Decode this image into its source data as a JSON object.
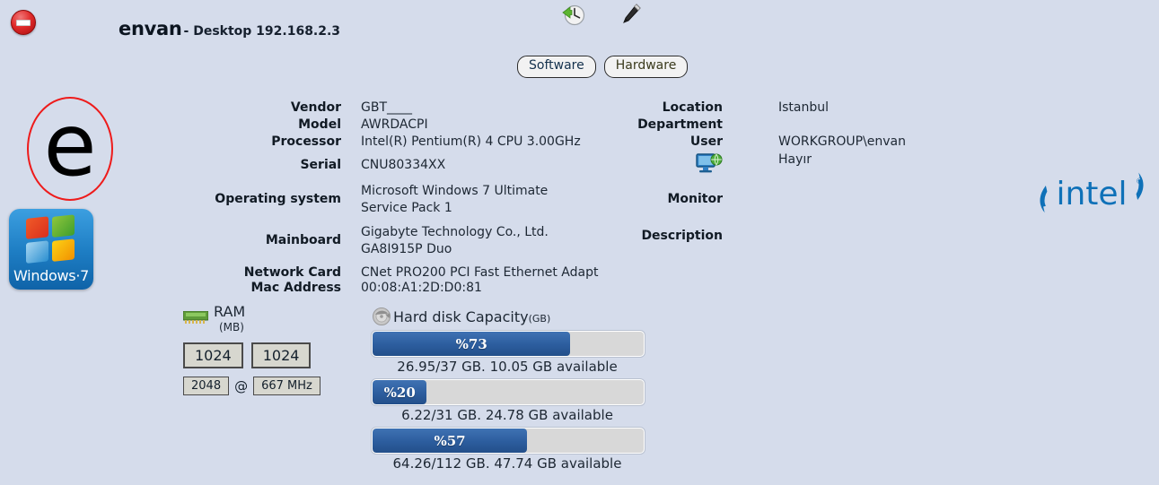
{
  "header": {
    "stop_icon": "stop-icon",
    "hostname": "envan",
    "subtitle": "- Desktop 192.168.2.3",
    "history_icon": "history-clock-icon",
    "pen_icon": "pen-edit-icon"
  },
  "tabs": [
    {
      "label": "Software",
      "name": "tab-software"
    },
    {
      "label": "Hardware",
      "name": "tab-hardware"
    }
  ],
  "branding": {
    "e_logo_letter": "e",
    "windows_logo_text": "Windows·7",
    "intel_logo_text": "intel",
    "ring_color": "#ee1b1b",
    "intel_blue": "#0f71b8"
  },
  "left_info": [
    {
      "label": "Vendor",
      "value": "GBT____"
    },
    {
      "label": "Model",
      "value": "AWRDACPI"
    },
    {
      "label": "Processor",
      "value": "Intel(R) Pentium(R) 4 CPU 3.00GHz"
    },
    {
      "label": "Serial",
      "value": "CNU80334XX"
    },
    {
      "label": "Operating system",
      "value": "Microsoft Windows 7 Ultimate\nService Pack 1"
    },
    {
      "label": "Mainboard",
      "value": "Gigabyte Technology Co., Ltd.\nGA8I915P Duo"
    },
    {
      "label": "Network Card\nMac Address",
      "value": "CNet PRO200 PCI Fast Ethernet Adapt\n00:08:A1:2D:D0:81"
    }
  ],
  "right_info": [
    {
      "label": "Location",
      "value": "Istanbul"
    },
    {
      "label": "Department",
      "value": ""
    },
    {
      "label": "User",
      "value": "WORKGROUP\\envan"
    },
    {
      "label": "",
      "value": "Hayır",
      "icon": "monitor-network-icon"
    },
    {
      "label": "Monitor",
      "value": ""
    },
    {
      "label": "Description",
      "value": ""
    }
  ],
  "ram": {
    "icon": "ram-module-icon",
    "title": "RAM",
    "unit": "(MB)",
    "slots": [
      "1024",
      "1024"
    ],
    "total": "2048",
    "at": "@",
    "speed": "667 MHz"
  },
  "disk": {
    "icon": "hard-disk-icon",
    "title": "Hard disk Capacity",
    "unit": "(GB)",
    "volumes": [
      {
        "percent_label": "%73",
        "percent": 73,
        "caption": "26.95/37 GB. 10.05 GB available"
      },
      {
        "percent_label": "%20",
        "percent": 20,
        "caption": "6.22/31 GB. 24.78 GB available"
      },
      {
        "percent_label": "%57",
        "percent": 57,
        "caption": "64.26/112 GB. 47.74 GB available"
      }
    ],
    "fill_color": "#2c5d9e",
    "track_color": "#d8d8d8"
  }
}
